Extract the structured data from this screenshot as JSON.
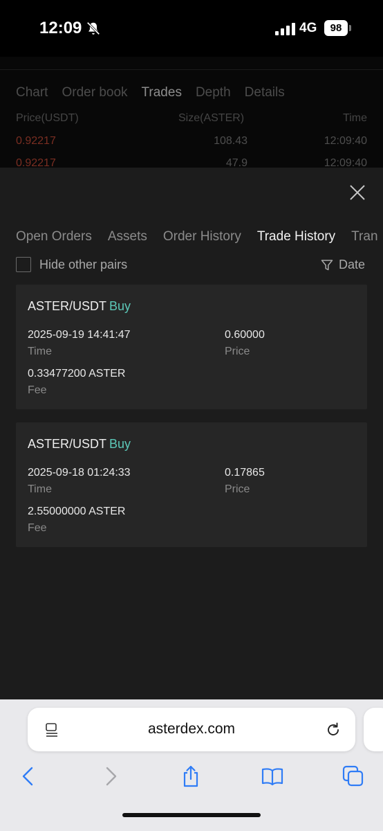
{
  "status_bar": {
    "time": "12:09",
    "network": "4G",
    "battery": "98"
  },
  "background_page": {
    "tabs": [
      "Chart",
      "Order book",
      "Trades",
      "Depth",
      "Details"
    ],
    "active_tab": "Trades",
    "columns": [
      "Price(USDT)",
      "Size(ASTER)",
      "Time"
    ],
    "rows": [
      {
        "price": "0.92217",
        "size": "108.43",
        "time": "12:09:40"
      },
      {
        "price": "0.92217",
        "size": "47.9",
        "time": "12:09:40"
      }
    ]
  },
  "sheet": {
    "tabs": [
      "Open Orders",
      "Assets",
      "Order History",
      "Trade History",
      "Tran"
    ],
    "active_tab": "Trade History",
    "hide_other_pairs_label": "Hide other pairs",
    "date_filter_label": "Date",
    "trades": [
      {
        "pair": "ASTER/USDT",
        "side": "Buy",
        "time_value": "2025-09-19 14:41:47",
        "time_label": "Time",
        "price_value": "0.60000",
        "price_label": "Price",
        "fee_value": "0.33477200 ASTER",
        "fee_label": "Fee"
      },
      {
        "pair": "ASTER/USDT",
        "side": "Buy",
        "time_value": "2025-09-18 01:24:33",
        "time_label": "Time",
        "price_value": "0.17865",
        "price_label": "Price",
        "fee_value": "2.55000000 ASTER",
        "fee_label": "Fee"
      }
    ]
  },
  "browser": {
    "url": "asterdex.com"
  },
  "colors": {
    "buy": "#5cc8b8",
    "sell_price": "#7a2e22",
    "sheet_background": "#1c1c1c",
    "card_background": "#262626",
    "safari_blue": "#2f7cf6"
  }
}
